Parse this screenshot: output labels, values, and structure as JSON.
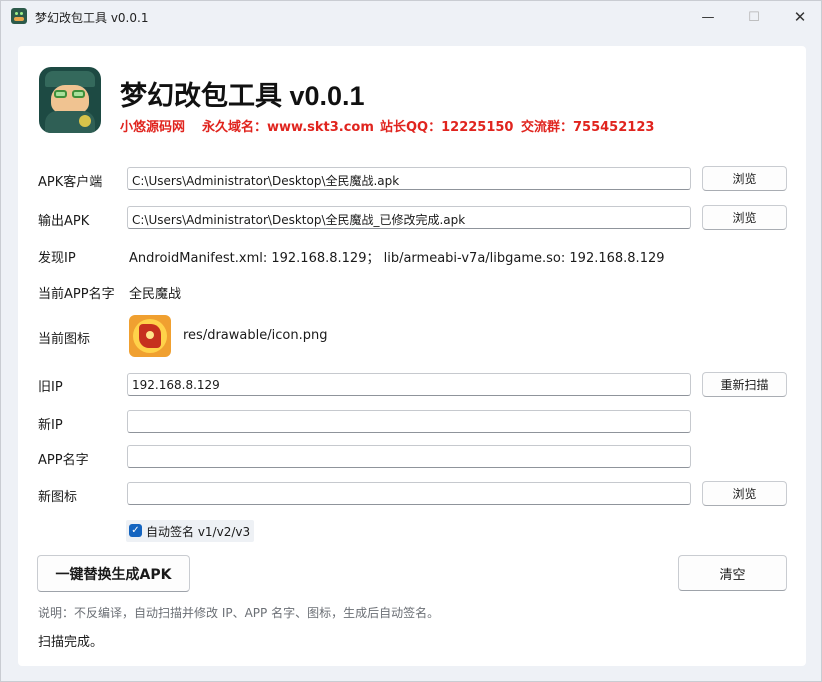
{
  "window": {
    "title": "梦幻改包工具 v0.0.1",
    "minimize_glyph": "—",
    "maximize_glyph": "☐",
    "close_glyph": "✕"
  },
  "header": {
    "title": "梦幻改包工具 v0.0.1",
    "site_name": "小悠源码网",
    "domain": "永久域名：www.skt3.com",
    "qq": "站长QQ：12225150",
    "group": "交流群：755452123"
  },
  "form": {
    "apk_client_label": "APK客户端",
    "apk_client_value": "C:\\Users\\Administrator\\Desktop\\全民魔战.apk",
    "output_apk_label": "输出APK",
    "output_apk_value": "C:\\Users\\Administrator\\Desktop\\全民魔战_已修改完成.apk",
    "found_ip_label": "发现IP",
    "found_ip_value": "AndroidManifest.xml: 192.168.8.129； lib/armeabi-v7a/libgame.so: 192.168.8.129",
    "current_app_name_label": "当前APP名字",
    "current_app_name_value": "全民魔战",
    "current_icon_label": "当前图标",
    "current_icon_path": "res/drawable/icon.png",
    "old_ip_label": "旧IP",
    "old_ip_value": "192.168.8.129",
    "new_ip_label": "新IP",
    "new_ip_value": "",
    "app_name_label": "APP名字",
    "app_name_value": "",
    "new_icon_label": "新图标",
    "new_icon_value": "",
    "browse_label": "浏览",
    "rescan_label": "重新扫描",
    "auto_sign_label": "自动签名 v1/v2/v3",
    "auto_sign_checked": true
  },
  "actions": {
    "generate_label": "一键替换生成APK",
    "clear_label": "清空"
  },
  "note": "说明：不反编译，自动扫描并修改 IP、APP 名字、图标，生成后自动签名。",
  "status": "扫描完成。",
  "colors": {
    "accent_red": "#e0241e",
    "checkbox_blue": "#1565c0"
  }
}
